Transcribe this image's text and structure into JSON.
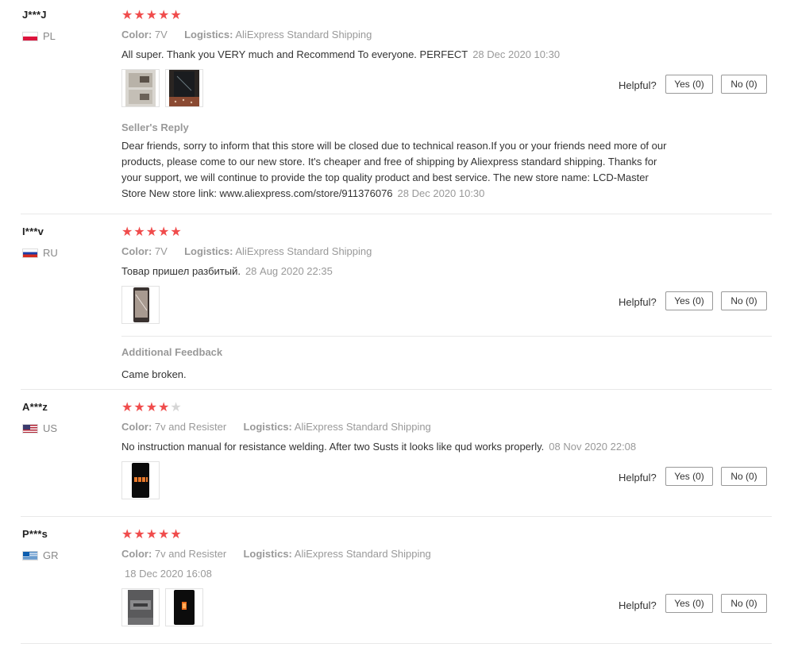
{
  "labels": {
    "color": "Color:",
    "logistics": "Logistics:",
    "helpful": "Helpful?",
    "sellers_reply": "Seller's Reply",
    "additional_feedback": "Additional Feedback"
  },
  "colors": {
    "star": "#f04c4c",
    "star_empty": "#d6d6d6",
    "muted": "#999999"
  },
  "reviews": [
    {
      "user": "J***J",
      "country": "PL",
      "rating": 5,
      "color": "7V",
      "logistics": "AliExpress Standard Shipping",
      "text": "All super. Thank you VERY much and Recommend To everyone. PERFECT",
      "date": "28 Dec 2020 10:30",
      "yes": "Yes (0)",
      "no": "No (0)",
      "photos": 2,
      "seller_reply": {
        "text": "Dear friends, sorry to inform that this store will be closed due to technical reason.If you or your friends need more of our products, please come to our new store. It's cheaper and free of shipping by Aliexpress standard shipping. Thanks for your support, we will continue to provide the top quality product and best service. The new store name: LCD-Master Store New store link: www.aliexpress.com/store/911376076",
        "date": "28 Dec 2020 10:30"
      }
    },
    {
      "user": "I***v",
      "country": "RU",
      "rating": 5,
      "color": "7V",
      "logistics": "AliExpress Standard Shipping",
      "text": "Товар пришел разбитый.",
      "date": "28 Aug 2020 22:35",
      "yes": "Yes (0)",
      "no": "No (0)",
      "photos": 1,
      "additional_feedback": "Came broken."
    },
    {
      "user": "A***z",
      "country": "US",
      "rating": 4,
      "color": "7v and Resister",
      "logistics": "AliExpress Standard Shipping",
      "text": "No instruction manual for resistance welding. After two Susts it looks like qud works properly.",
      "date": "08 Nov 2020 22:08",
      "yes": "Yes (0)",
      "no": "No (0)",
      "photos": 1
    },
    {
      "user": "P***s",
      "country": "GR",
      "rating": 5,
      "color": "7v and Resister",
      "logistics": "AliExpress Standard Shipping",
      "text": "",
      "date": "18 Dec 2020 16:08",
      "yes": "Yes (0)",
      "no": "No (0)",
      "photos": 2
    }
  ]
}
